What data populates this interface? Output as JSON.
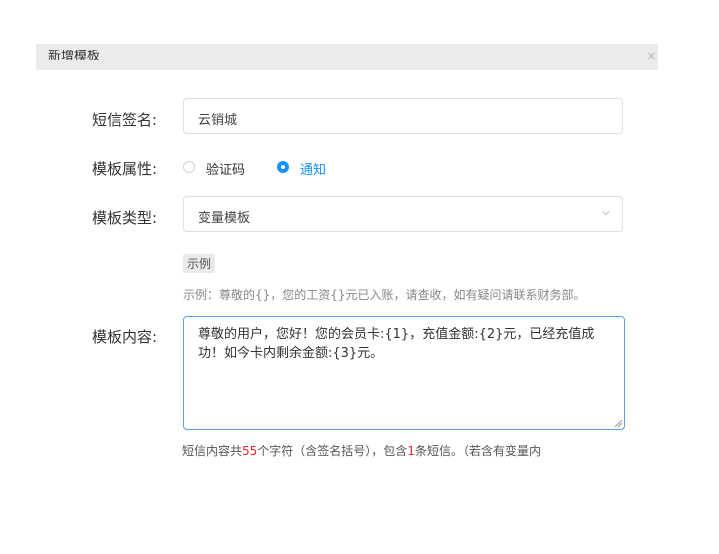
{
  "dialog": {
    "title": "新增模板"
  },
  "form": {
    "signature_label": "短信签名:",
    "signature_value": "云销城",
    "attribute_label": "模板属性:",
    "attribute_options": [
      {
        "label": "验证码",
        "checked": false
      },
      {
        "label": "通知",
        "checked": true
      }
    ],
    "type_label": "模板类型:",
    "type_value": "变量模板",
    "example_tag": "示例",
    "example_text": "示例：尊敬的{}，您的工资{}元已入账，请查收，如有疑问请联系财务部。",
    "content_label": "模板内容:",
    "content_value": "尊敬的用户，您好！您的会员卡:{1}，充值金额:{2}元，已经充值成功！如今卡内剩余金额:{3}元。",
    "count_prefix": "短信内容共",
    "count_chars": "55",
    "count_middle": "个字符（含签名括号），包含",
    "count_sms": "1",
    "count_suffix": "条短信。（若含有变量内"
  },
  "colors": {
    "accent": "#1890ff",
    "highlight": "#f5222d",
    "header_bg": "#ebebeb"
  }
}
